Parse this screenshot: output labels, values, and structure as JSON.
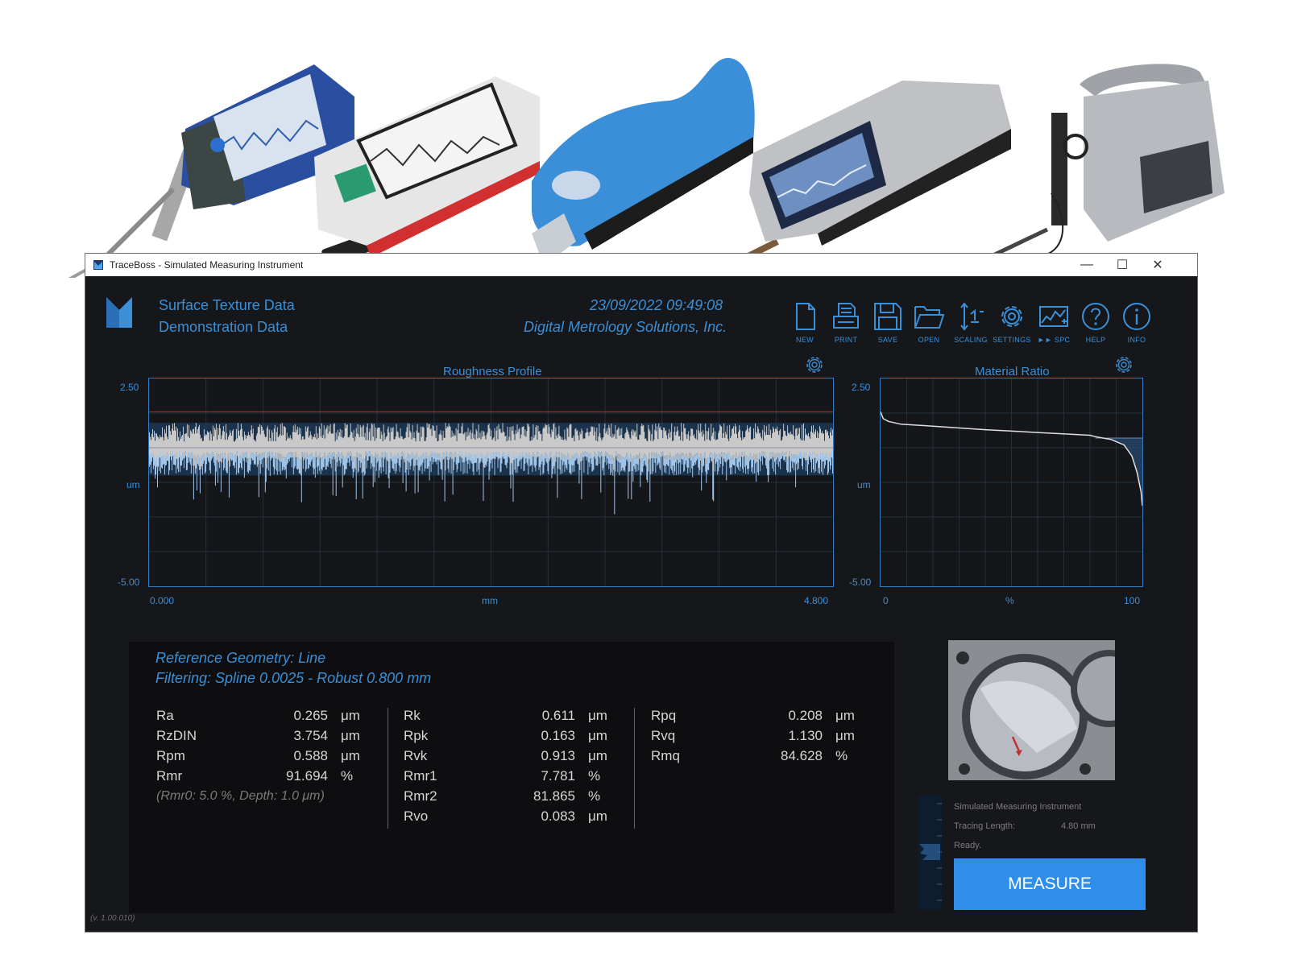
{
  "window": {
    "title": "TraceBoss - Simulated Measuring Instrument",
    "controls": {
      "minimize": "—",
      "maximize": "☐",
      "close": "✕"
    }
  },
  "header": {
    "line1": "Surface Texture Data",
    "line2": "Demonstration Data",
    "datetime": "23/09/2022  09:49:08",
    "company": "Digital Metrology Solutions, Inc."
  },
  "toolbar": {
    "new": "NEW",
    "print": "PRINT",
    "save": "SAVE",
    "open": "OPEN",
    "scaling": "SCALING",
    "settings": "SETTINGS",
    "spc": "►► SPC",
    "help": "HELP",
    "info": "INFO"
  },
  "colors": {
    "accent": "#3a8fd6",
    "button": "#2e8ee8",
    "background": "#16171b"
  },
  "chart_data": [
    {
      "type": "line",
      "title": "Roughness Profile",
      "xlabel": "mm",
      "ylabel": "um",
      "xlim": [
        0.0,
        4.8
      ],
      "ylim": [
        -5.0,
        2.5
      ],
      "x_tick_labels": [
        "0.000",
        "4.800"
      ],
      "y_tick_labels": [
        "2.50",
        "-5.00"
      ],
      "mean_line": 0.0,
      "upper_band": 1.3,
      "typical_peak": 0.9,
      "typical_valley": -1.0,
      "deepest_valley": -2.4,
      "grid": true
    },
    {
      "type": "line",
      "title": "Material Ratio",
      "xlabel": "%",
      "ylabel": "um",
      "xlim": [
        0,
        100
      ],
      "ylim": [
        -5.0,
        2.5
      ],
      "x_tick_labels": [
        "0",
        "100"
      ],
      "y_tick_labels": [
        "2.50",
        "-5.00"
      ],
      "points": [
        [
          0,
          1.3
        ],
        [
          1,
          1.05
        ],
        [
          3,
          0.95
        ],
        [
          7.8,
          0.85
        ],
        [
          20,
          0.78
        ],
        [
          40,
          0.65
        ],
        [
          60,
          0.55
        ],
        [
          80,
          0.45
        ],
        [
          81.9,
          0.4
        ],
        [
          88,
          0.3
        ],
        [
          93,
          0.1
        ],
        [
          96,
          -0.3
        ],
        [
          98,
          -0.9
        ],
        [
          99.5,
          -1.6
        ],
        [
          100,
          -2.1
        ]
      ],
      "grid": true
    }
  ],
  "results": {
    "reference": "Reference Geometry: Line",
    "filtering": "Filtering: Spline 0.0025 - Robust 0.800 mm",
    "col1": [
      {
        "name": "Ra",
        "value": "0.265",
        "unit": "μm"
      },
      {
        "name": "RzDIN",
        "value": "3.754",
        "unit": "μm"
      },
      {
        "name": "Rpm",
        "value": "0.588",
        "unit": "μm"
      },
      {
        "name": "Rmr",
        "value": "91.694",
        "unit": "%"
      }
    ],
    "col1_note": "(Rmr0: 5.0 %,  Depth: 1.0 μm)",
    "col2": [
      {
        "name": "Rk",
        "value": "0.611",
        "unit": "μm"
      },
      {
        "name": "Rpk",
        "value": "0.163",
        "unit": "μm"
      },
      {
        "name": "Rvk",
        "value": "0.913",
        "unit": "μm"
      },
      {
        "name": "Rmr1",
        "value": "7.781",
        "unit": "%"
      },
      {
        "name": "Rmr2",
        "value": "81.865",
        "unit": "%"
      },
      {
        "name": "Rvo",
        "value": "0.083",
        "unit": "μm"
      }
    ],
    "col3": [
      {
        "name": "Rpq",
        "value": "0.208",
        "unit": "μm"
      },
      {
        "name": "Rvq",
        "value": "1.130",
        "unit": "μm"
      },
      {
        "name": "Rmq",
        "value": "84.628",
        "unit": "%"
      }
    ]
  },
  "status": {
    "instrument": "Simulated Measuring Instrument",
    "tracing_label": "Tracing Length:",
    "tracing_value": "4.80 mm",
    "state": "Ready."
  },
  "measure_label": "MEASURE",
  "version": "(v. 1.00.010)"
}
